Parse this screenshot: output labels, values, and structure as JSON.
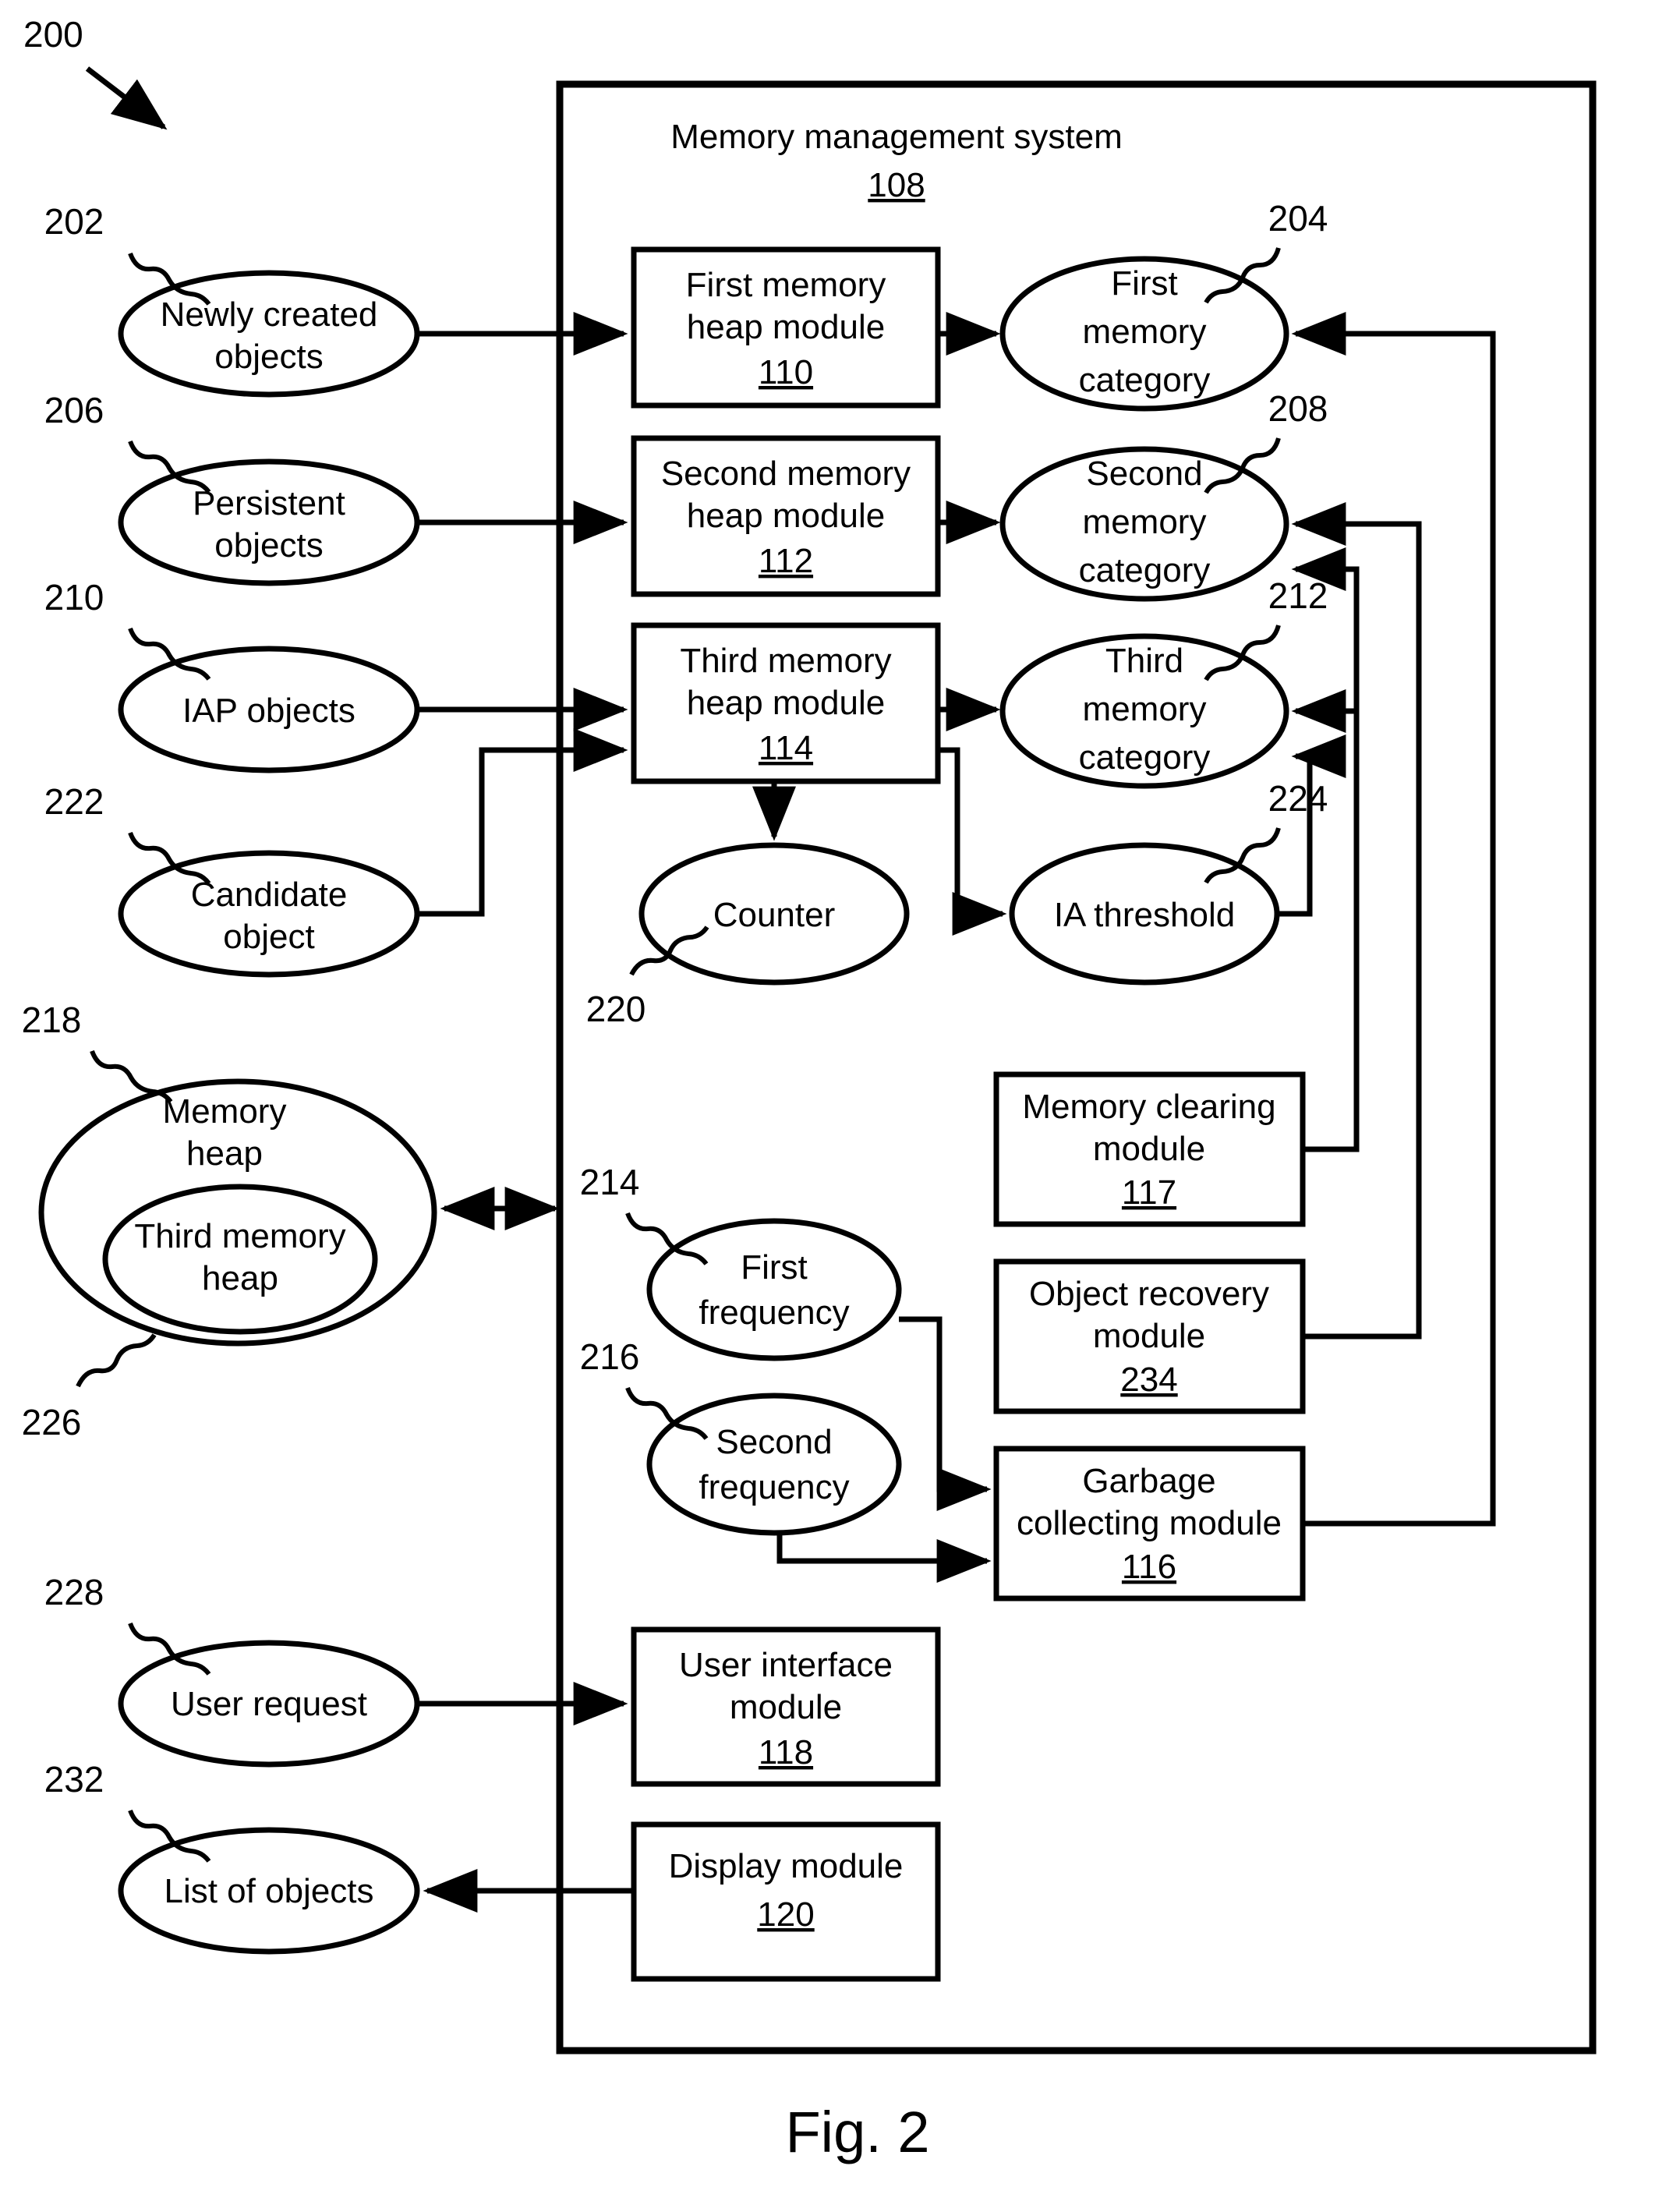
{
  "figure": {
    "caption": "Fig. 2",
    "diagram_ref": "200"
  },
  "container": {
    "title": "Memory management system",
    "ref": "108"
  },
  "external_nodes": [
    {
      "id": "newly-created-objects",
      "label_line1": "Newly created",
      "label_line2": "objects",
      "ref": "202"
    },
    {
      "id": "persistent-objects",
      "label_line1": "Persistent",
      "label_line2": "objects",
      "ref": "206"
    },
    {
      "id": "iap-objects",
      "label_line1": "IAP objects",
      "label_line2": "",
      "ref": "210"
    },
    {
      "id": "candidate-object",
      "label_line1": "Candidate",
      "label_line2": "object",
      "ref": "222"
    },
    {
      "id": "memory-heap",
      "label_line1": "Memory",
      "label_line2": "heap",
      "ref": "218"
    },
    {
      "id": "third-memory-heap",
      "label_line1": "Third memory",
      "label_line2": "heap",
      "ref": "226"
    },
    {
      "id": "user-request",
      "label_line1": "User request",
      "label_line2": "",
      "ref": "228"
    },
    {
      "id": "list-of-objects",
      "label_line1": "List of objects",
      "label_line2": "",
      "ref": "232"
    }
  ],
  "modules": [
    {
      "id": "first-memory-heap-module",
      "line1": "First memory",
      "line2": "heap module",
      "ref": "110"
    },
    {
      "id": "second-memory-heap-module",
      "line1": "Second memory",
      "line2": "heap module",
      "ref": "112"
    },
    {
      "id": "third-memory-heap-module",
      "line1": "Third memory",
      "line2": "heap module",
      "ref": "114"
    },
    {
      "id": "memory-clearing-module",
      "line1": "Memory clearing",
      "line2": "module",
      "ref": "117"
    },
    {
      "id": "object-recovery-module",
      "line1": "Object recovery",
      "line2": "module",
      "ref": "234"
    },
    {
      "id": "garbage-collecting-module",
      "line1": "Garbage",
      "line2": "collecting module",
      "ref": "116"
    },
    {
      "id": "user-interface-module",
      "line1": "User interface",
      "line2": "module",
      "ref": "118"
    },
    {
      "id": "display-module",
      "line1": "Display module",
      "line2": "",
      "ref": "120"
    }
  ],
  "internal_nodes": [
    {
      "id": "first-memory-category",
      "line1": "First",
      "line2": "memory",
      "line3": "category",
      "ref": "204"
    },
    {
      "id": "second-memory-category",
      "line1": "Second",
      "line2": "memory",
      "line3": "category",
      "ref": "208"
    },
    {
      "id": "third-memory-category",
      "line1": "Third",
      "line2": "memory",
      "line3": "category",
      "ref": "212"
    },
    {
      "id": "counter",
      "line1": "Counter",
      "line2": "",
      "line3": "",
      "ref": "220"
    },
    {
      "id": "ia-threshold",
      "line1": "IA threshold",
      "line2": "",
      "line3": "",
      "ref": "224"
    },
    {
      "id": "first-frequency",
      "line1": "First",
      "line2": "frequency",
      "line3": "",
      "ref": "214"
    },
    {
      "id": "second-frequency",
      "line1": "Second",
      "line2": "frequency",
      "line3": "",
      "ref": "216"
    }
  ],
  "colors": {
    "stroke": "#000000",
    "background": "#ffffff"
  }
}
